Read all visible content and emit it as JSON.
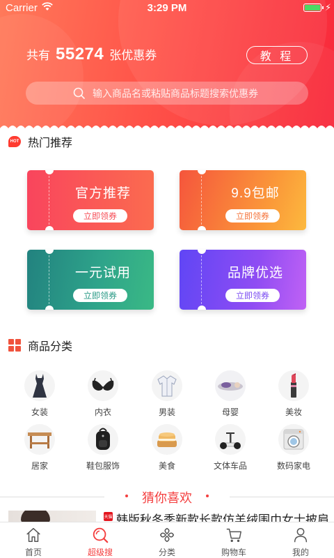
{
  "status_bar": {
    "carrier": "Carrier",
    "time": "3:29 PM"
  },
  "header": {
    "coupon_prefix": "共有",
    "coupon_count": "55274",
    "coupon_suffix": "张优惠券",
    "tutorial_label": "教 程",
    "search_placeholder": "输入商品名或粘贴商品标题搜索优惠券"
  },
  "hot": {
    "badge": "HOT",
    "title": "热门推荐",
    "tickets": [
      {
        "title": "官方推荐",
        "button": "立即领券"
      },
      {
        "title": "9.9包邮",
        "button": "立即领券"
      },
      {
        "title": "一元试用",
        "button": "立即领券"
      },
      {
        "title": "品牌优选",
        "button": "立即领券"
      }
    ]
  },
  "categories": {
    "title": "商品分类",
    "items": [
      {
        "label": "女装",
        "icon": "dress-icon"
      },
      {
        "label": "内衣",
        "icon": "bra-icon"
      },
      {
        "label": "男装",
        "icon": "shirt-icon"
      },
      {
        "label": "母婴",
        "icon": "baby-pillow-icon"
      },
      {
        "label": "美妆",
        "icon": "lipstick-icon"
      },
      {
        "label": "居家",
        "icon": "table-icon"
      },
      {
        "label": "鞋包服饰",
        "icon": "backpack-icon"
      },
      {
        "label": "美食",
        "icon": "cake-icon"
      },
      {
        "label": "文体车品",
        "icon": "scooter-icon"
      },
      {
        "label": "数码家电",
        "icon": "washing-machine-icon"
      }
    ]
  },
  "guess": {
    "title": "猜你喜欢",
    "product": {
      "tag": "天猫",
      "title": "韩版秋冬季新款长款仿羊绒围巾女士披肩"
    }
  },
  "tabbar": {
    "active_color": "#f43f3f",
    "tabs": [
      {
        "label": "首页",
        "icon": "home-icon"
      },
      {
        "label": "超级搜",
        "icon": "search-icon"
      },
      {
        "label": "分类",
        "icon": "category-icon"
      },
      {
        "label": "购物车",
        "icon": "cart-icon"
      },
      {
        "label": "我的",
        "icon": "profile-icon"
      }
    ]
  }
}
